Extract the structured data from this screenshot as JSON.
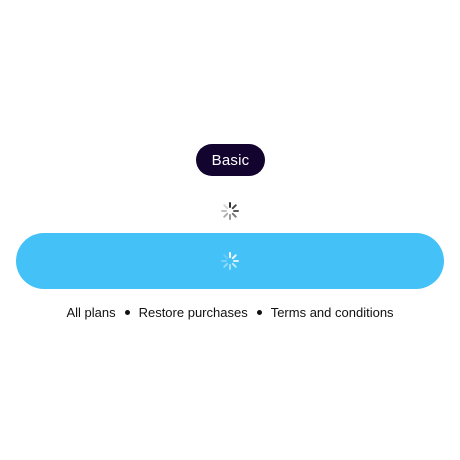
{
  "plan": {
    "label": "Basic"
  },
  "spinners": {
    "top": "activity-spinner-icon",
    "button": "activity-spinner-icon"
  },
  "colors": {
    "plan_pill_bg": "#13032f",
    "cta_bg": "#44c1f6",
    "spinner_dark": "#333333",
    "spinner_light": "#ffffff"
  },
  "footer": {
    "links": [
      {
        "label": "All plans"
      },
      {
        "label": "Restore purchases"
      },
      {
        "label": "Terms and conditions"
      }
    ]
  }
}
